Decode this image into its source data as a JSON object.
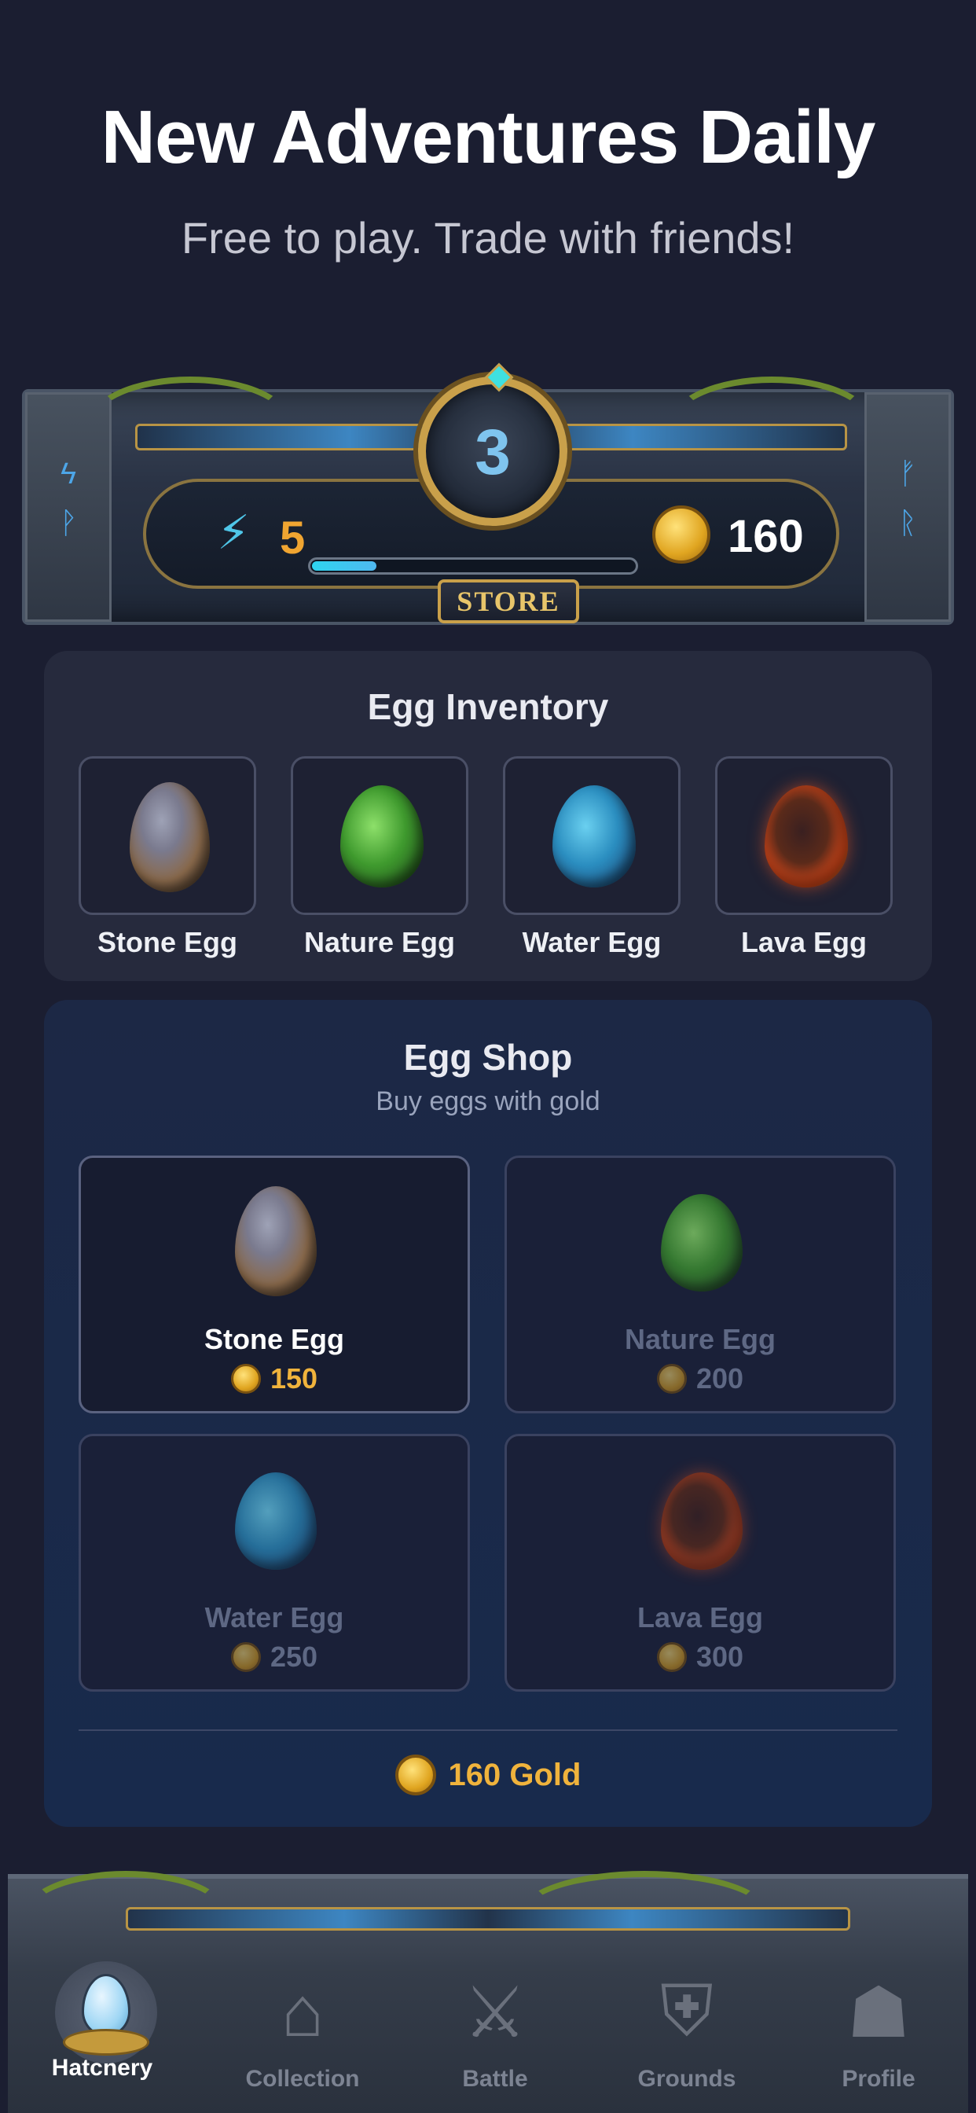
{
  "header": {
    "title": "New Adventures Daily",
    "subtitle": "Free to play. Trade with friends!"
  },
  "status_bar": {
    "energy": "5",
    "level": "3",
    "gold": "160",
    "progress_fraction": 0.2,
    "store_label": "STORE",
    "energy_icon": "lightning-icon",
    "gold_icon": "gold-coin-icon"
  },
  "inventory": {
    "title": "Egg Inventory",
    "items": [
      {
        "label": "Stone Egg",
        "kind": "stone"
      },
      {
        "label": "Nature Egg",
        "kind": "nature"
      },
      {
        "label": "Water Egg",
        "kind": "water"
      },
      {
        "label": "Lava Egg",
        "kind": "lava"
      }
    ]
  },
  "shop": {
    "title": "Egg Shop",
    "subtitle": "Buy eggs with gold",
    "items": [
      {
        "name": "Stone Egg",
        "price": "150",
        "affordable": true
      },
      {
        "name": "Nature Egg",
        "price": "200",
        "affordable": false
      },
      {
        "name": "Water Egg",
        "price": "250",
        "affordable": false
      },
      {
        "name": "Lava Egg",
        "price": "300",
        "affordable": false
      }
    ],
    "gold_total": "160 Gold"
  },
  "nav": {
    "items": [
      {
        "label": "Hatchery",
        "icon": "egg-nest-icon",
        "active": true
      },
      {
        "label": "Collection",
        "icon": "house-icon",
        "active": false
      },
      {
        "label": "Battle",
        "icon": "crossed-swords-icon",
        "active": false
      },
      {
        "label": "Grounds",
        "icon": "shield-sword-icon",
        "active": false
      },
      {
        "label": "Profile",
        "icon": "hooded-figure-icon",
        "active": false
      }
    ]
  },
  "colors": {
    "background": "#1b1e31",
    "accent_gold": "#f0b33c",
    "energy_blue": "#4fc6e8",
    "level_blue": "#7fc4ee"
  }
}
